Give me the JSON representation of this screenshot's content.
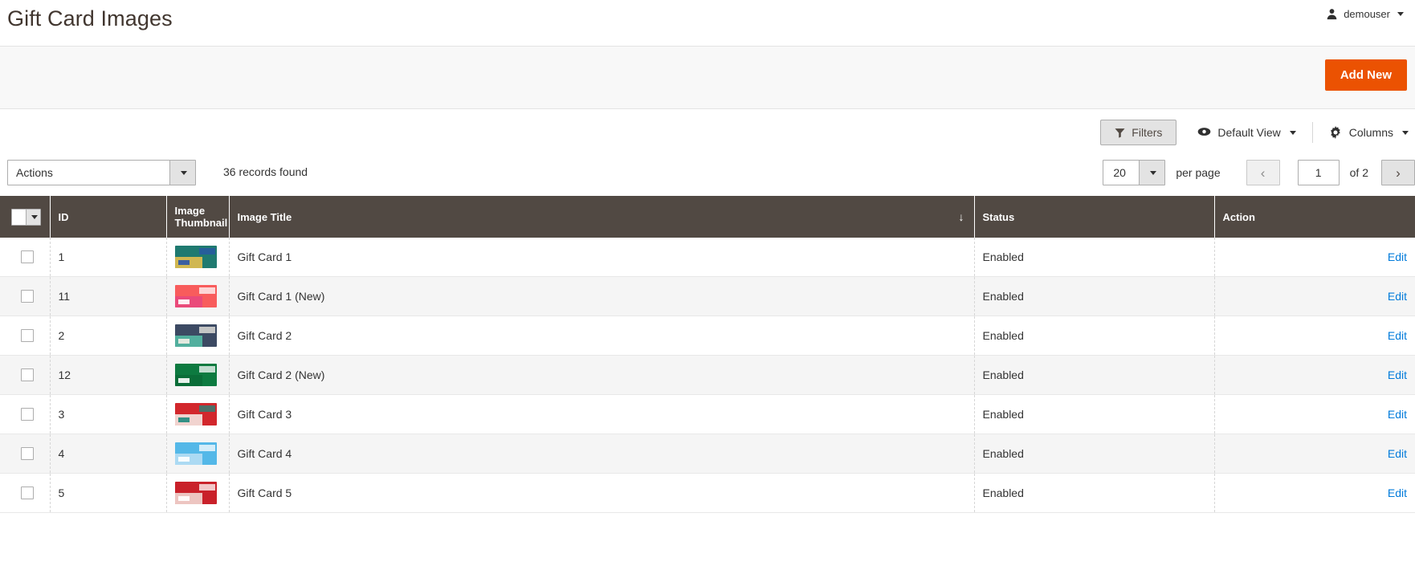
{
  "header": {
    "title": "Gift Card Images",
    "user_name": "demouser",
    "user_icon": "user-icon",
    "caret_icon": "chevron-down-icon"
  },
  "action_bar": {
    "add_new_label": "Add New",
    "add_new_color": "#eb5202"
  },
  "grid_toolbar": {
    "filters_label": "Filters",
    "filters_icon": "funnel-icon",
    "view_label": "Default View",
    "view_icon": "eye-icon",
    "columns_label": "Columns",
    "columns_icon": "gear-icon"
  },
  "controls": {
    "actions_label": "Actions",
    "records_found": "36 records found",
    "per_page_value": "20",
    "per_page_label": "per page",
    "current_page": "1",
    "of_pages": "of 2",
    "prev_icon": "chevron-left-icon",
    "next_icon": "chevron-right-icon"
  },
  "table": {
    "columns": [
      {
        "key": "check",
        "label": ""
      },
      {
        "key": "id",
        "label": "ID"
      },
      {
        "key": "thumbnail",
        "label": "Image Thumbnail"
      },
      {
        "key": "title",
        "label": "Image Title"
      },
      {
        "key": "status",
        "label": "Status"
      },
      {
        "key": "action",
        "label": "Action"
      }
    ],
    "sort_indicator": "↓",
    "sorted_column": "Image Title",
    "edit_label": "Edit",
    "edit_color": "#007bdb",
    "rows": [
      {
        "id": "1",
        "title": "Gift Card 1",
        "status": "Enabled",
        "action": "Edit",
        "thumb_colors": [
          "#1f7a70",
          "#f0c24b",
          "#2a55a8"
        ]
      },
      {
        "id": "11",
        "title": "Gift Card 1 (New)",
        "status": "Enabled",
        "action": "Edit",
        "thumb_colors": [
          "#f85c5c",
          "#e8467f",
          "#ffffff"
        ]
      },
      {
        "id": "2",
        "title": "Gift Card 2",
        "status": "Enabled",
        "action": "Edit",
        "thumb_colors": [
          "#3c4a63",
          "#56c1a8",
          "#f2efe6"
        ]
      },
      {
        "id": "12",
        "title": "Gift Card 2 (New)",
        "status": "Enabled",
        "action": "Edit",
        "thumb_colors": [
          "#0d7a40",
          "#0a6b37",
          "#ffffff"
        ]
      },
      {
        "id": "3",
        "title": "Gift Card 3",
        "status": "Enabled",
        "action": "Edit",
        "thumb_colors": [
          "#d2272c",
          "#f7f2ec",
          "#1f8a7c"
        ]
      },
      {
        "id": "4",
        "title": "Gift Card 4",
        "status": "Enabled",
        "action": "Edit",
        "thumb_colors": [
          "#54b8e8",
          "#bcdff5",
          "#ffffff"
        ]
      },
      {
        "id": "5",
        "title": "Gift Card 5",
        "status": "Enabled",
        "action": "Edit",
        "thumb_colors": [
          "#c9212a",
          "#f3e2dc",
          "#ffffff"
        ]
      }
    ]
  }
}
